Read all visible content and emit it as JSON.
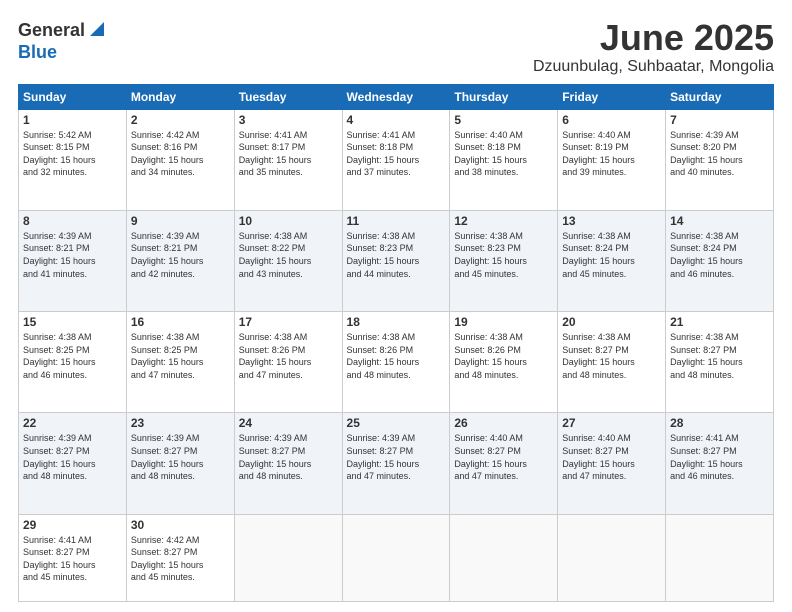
{
  "header": {
    "logo_line1": "General",
    "logo_line2": "Blue",
    "month": "June 2025",
    "location": "Dzuunbulag, Suhbaatar, Mongolia"
  },
  "days_of_week": [
    "Sunday",
    "Monday",
    "Tuesday",
    "Wednesday",
    "Thursday",
    "Friday",
    "Saturday"
  ],
  "weeks": [
    [
      {
        "day": "1",
        "sunrise": "5:42 AM",
        "sunset": "8:15 PM",
        "daylight": "15 hours and 32 minutes."
      },
      {
        "day": "2",
        "sunrise": "4:42 AM",
        "sunset": "8:16 PM",
        "daylight": "15 hours and 34 minutes."
      },
      {
        "day": "3",
        "sunrise": "4:41 AM",
        "sunset": "8:17 PM",
        "daylight": "15 hours and 35 minutes."
      },
      {
        "day": "4",
        "sunrise": "4:41 AM",
        "sunset": "8:18 PM",
        "daylight": "15 hours and 37 minutes."
      },
      {
        "day": "5",
        "sunrise": "4:40 AM",
        "sunset": "8:18 PM",
        "daylight": "15 hours and 38 minutes."
      },
      {
        "day": "6",
        "sunrise": "4:40 AM",
        "sunset": "8:19 PM",
        "daylight": "15 hours and 39 minutes."
      },
      {
        "day": "7",
        "sunrise": "4:39 AM",
        "sunset": "8:20 PM",
        "daylight": "15 hours and 40 minutes."
      }
    ],
    [
      {
        "day": "8",
        "sunrise": "4:39 AM",
        "sunset": "8:21 PM",
        "daylight": "15 hours and 41 minutes."
      },
      {
        "day": "9",
        "sunrise": "4:39 AM",
        "sunset": "8:21 PM",
        "daylight": "15 hours and 42 minutes."
      },
      {
        "day": "10",
        "sunrise": "4:38 AM",
        "sunset": "8:22 PM",
        "daylight": "15 hours and 43 minutes."
      },
      {
        "day": "11",
        "sunrise": "4:38 AM",
        "sunset": "8:23 PM",
        "daylight": "15 hours and 44 minutes."
      },
      {
        "day": "12",
        "sunrise": "4:38 AM",
        "sunset": "8:23 PM",
        "daylight": "15 hours and 45 minutes."
      },
      {
        "day": "13",
        "sunrise": "4:38 AM",
        "sunset": "8:24 PM",
        "daylight": "15 hours and 45 minutes."
      },
      {
        "day": "14",
        "sunrise": "4:38 AM",
        "sunset": "8:24 PM",
        "daylight": "15 hours and 46 minutes."
      }
    ],
    [
      {
        "day": "15",
        "sunrise": "4:38 AM",
        "sunset": "8:25 PM",
        "daylight": "15 hours and 46 minutes."
      },
      {
        "day": "16",
        "sunrise": "4:38 AM",
        "sunset": "8:25 PM",
        "daylight": "15 hours and 47 minutes."
      },
      {
        "day": "17",
        "sunrise": "4:38 AM",
        "sunset": "8:26 PM",
        "daylight": "15 hours and 47 minutes."
      },
      {
        "day": "18",
        "sunrise": "4:38 AM",
        "sunset": "8:26 PM",
        "daylight": "15 hours and 48 minutes."
      },
      {
        "day": "19",
        "sunrise": "4:38 AM",
        "sunset": "8:26 PM",
        "daylight": "15 hours and 48 minutes."
      },
      {
        "day": "20",
        "sunrise": "4:38 AM",
        "sunset": "8:27 PM",
        "daylight": "15 hours and 48 minutes."
      },
      {
        "day": "21",
        "sunrise": "4:38 AM",
        "sunset": "8:27 PM",
        "daylight": "15 hours and 48 minutes."
      }
    ],
    [
      {
        "day": "22",
        "sunrise": "4:39 AM",
        "sunset": "8:27 PM",
        "daylight": "15 hours and 48 minutes."
      },
      {
        "day": "23",
        "sunrise": "4:39 AM",
        "sunset": "8:27 PM",
        "daylight": "15 hours and 48 minutes."
      },
      {
        "day": "24",
        "sunrise": "4:39 AM",
        "sunset": "8:27 PM",
        "daylight": "15 hours and 48 minutes."
      },
      {
        "day": "25",
        "sunrise": "4:39 AM",
        "sunset": "8:27 PM",
        "daylight": "15 hours and 47 minutes."
      },
      {
        "day": "26",
        "sunrise": "4:40 AM",
        "sunset": "8:27 PM",
        "daylight": "15 hours and 47 minutes."
      },
      {
        "day": "27",
        "sunrise": "4:40 AM",
        "sunset": "8:27 PM",
        "daylight": "15 hours and 47 minutes."
      },
      {
        "day": "28",
        "sunrise": "4:41 AM",
        "sunset": "8:27 PM",
        "daylight": "15 hours and 46 minutes."
      }
    ],
    [
      {
        "day": "29",
        "sunrise": "4:41 AM",
        "sunset": "8:27 PM",
        "daylight": "15 hours and 45 minutes."
      },
      {
        "day": "30",
        "sunrise": "4:42 AM",
        "sunset": "8:27 PM",
        "daylight": "15 hours and 45 minutes."
      },
      null,
      null,
      null,
      null,
      null
    ]
  ]
}
